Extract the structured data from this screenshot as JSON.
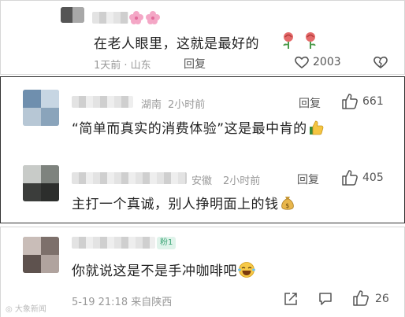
{
  "comments": [
    {
      "location": "",
      "time": "1天前 · 山东",
      "content": "在老人眼里，这就是最好的",
      "reply_label": "回复",
      "like_count": "2003",
      "emojis": [
        "rose-emoji",
        "rose-emoji"
      ],
      "name_emojis": [
        "cherry-blossom-emoji",
        "cherry-blossom-emoji"
      ]
    },
    {
      "location": "湖南",
      "time": "2小时前",
      "content": "“简单而真实的消费体验”这是最中肯的",
      "reply_label": "回复",
      "like_count": "661",
      "emojis": [
        "thumbs-up-emoji"
      ]
    },
    {
      "location": "安徽",
      "time": "2小时前",
      "content": "主打一个真诚，别人挣明面上的钱",
      "reply_label": "回复",
      "like_count": "405",
      "emojis": [
        "money-bag-emoji"
      ]
    },
    {
      "badge": "粉1",
      "time": "5-19 21:18 来自陕西",
      "content": "你就说这是不是手冲咖啡吧",
      "like_count": "26",
      "emojis": [
        "laughing-emoji"
      ]
    }
  ],
  "watermark": "大象新闻",
  "colors": {
    "badge_bg": "#dff3ea",
    "badge_text": "#3fa678",
    "meta": "#999999",
    "border_active": "#333333"
  }
}
